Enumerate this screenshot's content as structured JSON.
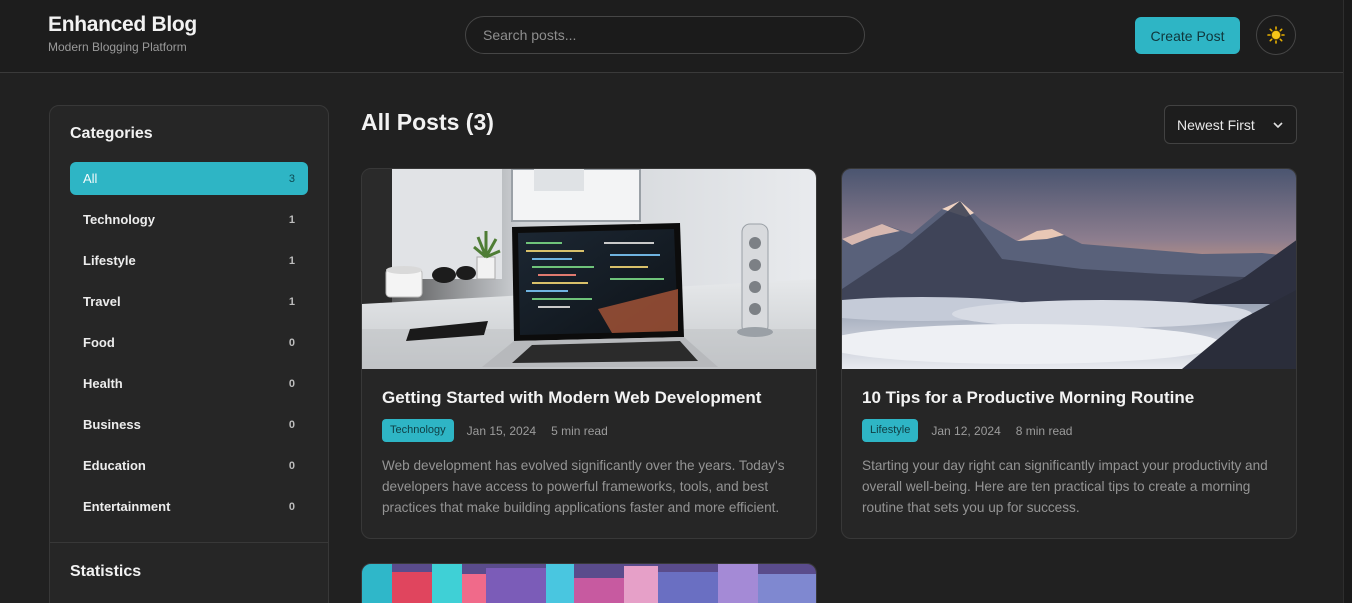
{
  "header": {
    "title": "Enhanced Blog",
    "subtitle": "Modern Blogging Platform",
    "search_placeholder": "Search posts...",
    "create_label": "Create Post",
    "theme_icon": "sun-icon"
  },
  "sidebar": {
    "categories_heading": "Categories",
    "categories": [
      {
        "label": "All",
        "count": "3",
        "active": true
      },
      {
        "label": "Technology",
        "count": "1"
      },
      {
        "label": "Lifestyle",
        "count": "1"
      },
      {
        "label": "Travel",
        "count": "1"
      },
      {
        "label": "Food",
        "count": "0"
      },
      {
        "label": "Health",
        "count": "0"
      },
      {
        "label": "Business",
        "count": "0"
      },
      {
        "label": "Education",
        "count": "0"
      },
      {
        "label": "Entertainment",
        "count": "0"
      }
    ],
    "statistics_heading": "Statistics"
  },
  "main": {
    "title": "All Posts (3)",
    "sort_selected": "Newest First",
    "posts": [
      {
        "title": "Getting Started with Modern Web Development",
        "category": "Technology",
        "date": "Jan 15, 2024",
        "read_time": "5 min read",
        "excerpt": "Web development has evolved significantly over the years. Today's developers have access to powerful frameworks, tools, and best practices that make building applications faster and more efficient."
      },
      {
        "title": "10 Tips for a Productive Morning Routine",
        "category": "Lifestyle",
        "date": "Jan 12, 2024",
        "read_time": "8 min read",
        "excerpt": "Starting your day right can significantly impact your productivity and overall well-being. Here are ten practical tips to create a morning routine that sets you up for success."
      }
    ]
  },
  "colors": {
    "accent": "#2eb5c5",
    "background": "#212121",
    "surface": "#262626"
  }
}
